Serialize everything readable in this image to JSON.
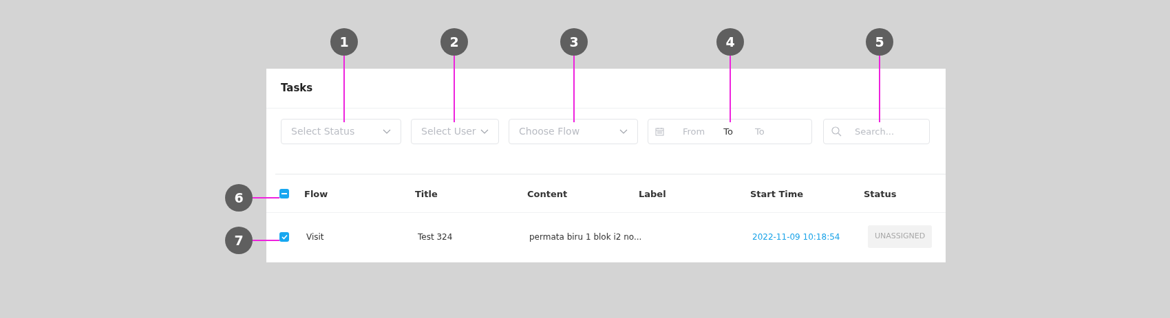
{
  "panel": {
    "title": "Tasks"
  },
  "filters": {
    "status": {
      "placeholder": "Select Status"
    },
    "user": {
      "placeholder": "Select User"
    },
    "flow": {
      "placeholder": "Choose Flow"
    },
    "date_range": {
      "from_placeholder": "From",
      "separator": "To",
      "to_placeholder": "To"
    },
    "search": {
      "placeholder": "Search..."
    }
  },
  "table": {
    "select_all": {
      "indeterminate": true
    },
    "columns": [
      "Flow",
      "Title",
      "Content",
      "Label",
      "Start Time",
      "Status"
    ],
    "rows": [
      {
        "checked": true,
        "flow": "Visit",
        "title": "Test 324",
        "content": "permata biru 1 blok i2 no...",
        "start_time": "2022-11-09 10:18:54",
        "status": "UNASSIGNED"
      }
    ]
  },
  "callouts": [
    {
      "number": "1",
      "kind": "top"
    },
    {
      "number": "2",
      "kind": "top"
    },
    {
      "number": "3",
      "kind": "top"
    },
    {
      "number": "4",
      "kind": "top"
    },
    {
      "number": "5",
      "kind": "top"
    },
    {
      "number": "6",
      "kind": "left"
    },
    {
      "number": "7",
      "kind": "left"
    }
  ]
}
